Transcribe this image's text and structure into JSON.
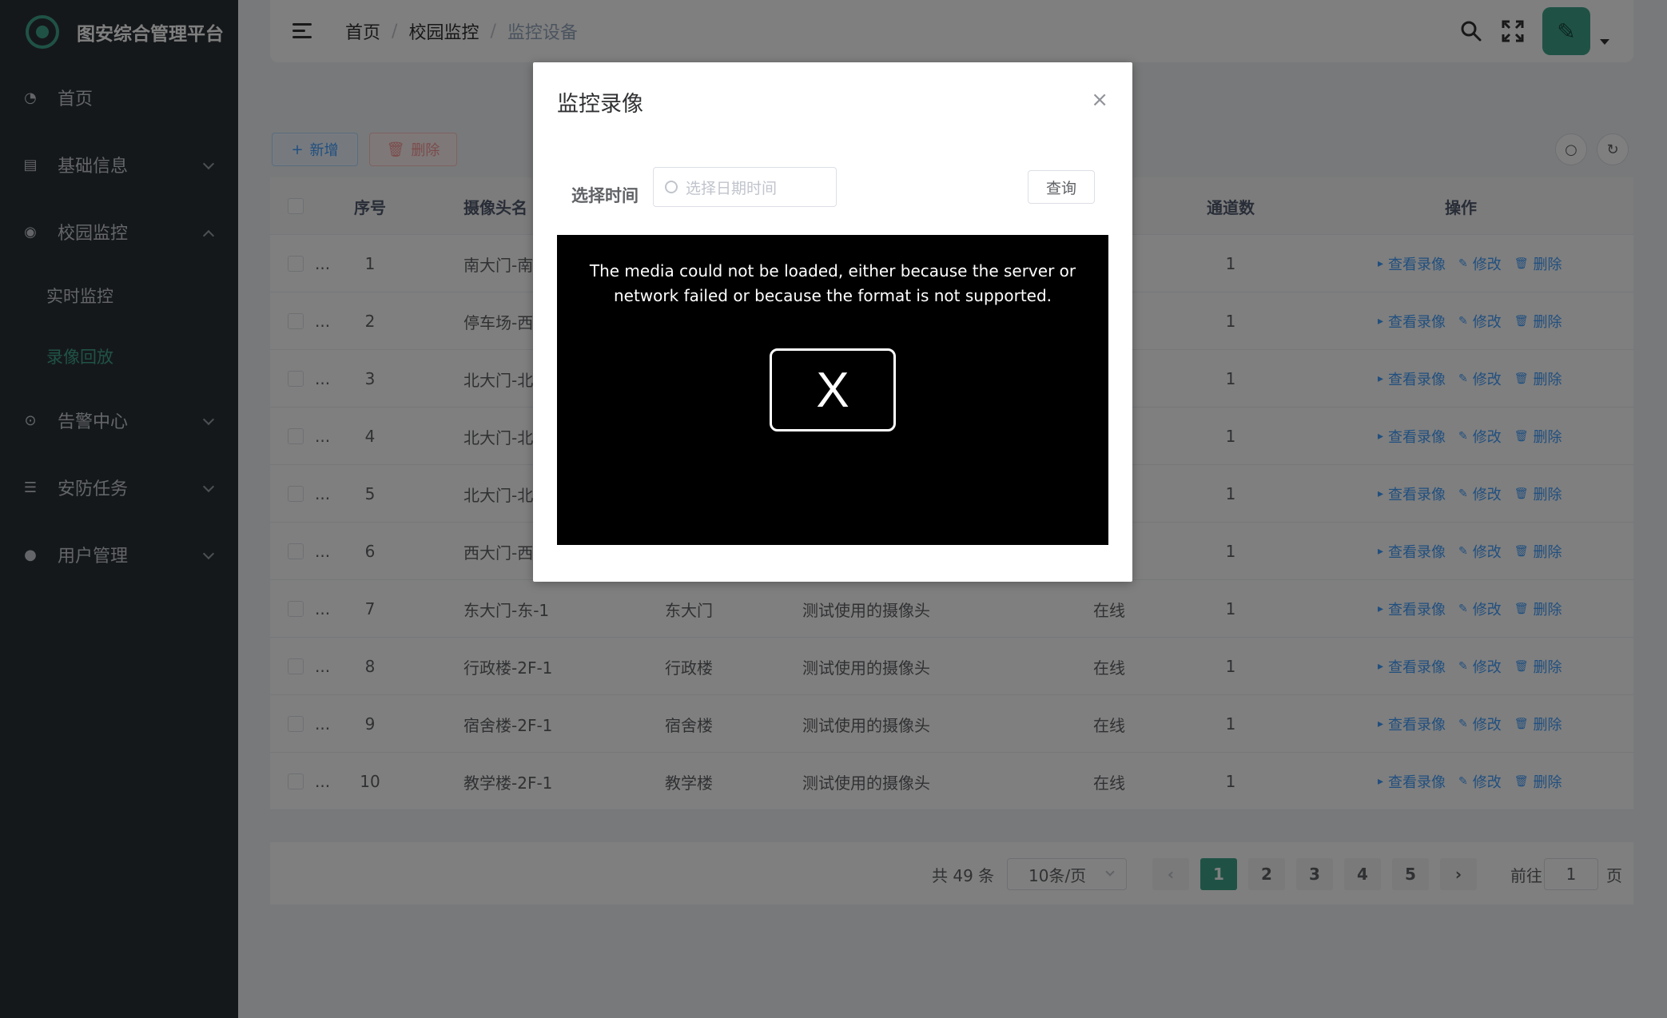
{
  "app": {
    "title": "图安综合管理平台"
  },
  "sidebar": {
    "items": [
      {
        "label": "首页",
        "icon": "dashboard-icon"
      },
      {
        "label": "基础信息",
        "icon": "document-icon"
      },
      {
        "label": "校园监控",
        "icon": "eye-icon",
        "expanded": true
      },
      {
        "label": "告警中心",
        "icon": "alarm-icon"
      },
      {
        "label": "安防任务",
        "icon": "list-icon"
      },
      {
        "label": "用户管理",
        "icon": "user-icon"
      }
    ],
    "submenu": [
      {
        "label": "实时监控"
      },
      {
        "label": "录像回放",
        "active": true
      }
    ]
  },
  "header": {
    "breadcrumb": [
      "首页",
      "校园监控",
      "监控设备"
    ],
    "separator": "/"
  },
  "toolbar": {
    "add_label": "新增",
    "delete_label": "删除"
  },
  "table": {
    "headers": {
      "index": "序号",
      "name": "摄像头名",
      "channels": "通道数",
      "ops": "操作"
    },
    "ops": {
      "view": "查看录像",
      "edit": "修改",
      "delete": "删除"
    },
    "rows": [
      {
        "index": "1",
        "name": "南大门-南",
        "area": "",
        "desc": "",
        "status": "",
        "channels": "1"
      },
      {
        "index": "2",
        "name": "停车场-西",
        "area": "",
        "desc": "",
        "status": "",
        "channels": "1"
      },
      {
        "index": "3",
        "name": "北大门-北",
        "area": "",
        "desc": "",
        "status": "",
        "channels": "1"
      },
      {
        "index": "4",
        "name": "北大门-北",
        "area": "",
        "desc": "",
        "status": "",
        "channels": "1"
      },
      {
        "index": "5",
        "name": "北大门-北",
        "area": "",
        "desc": "",
        "status": "",
        "channels": "1"
      },
      {
        "index": "6",
        "name": "西大门-西",
        "area": "",
        "desc": "",
        "status": "",
        "channels": "1"
      },
      {
        "index": "7",
        "name": "东大门-东-1",
        "area": "东大门",
        "desc": "测试使用的摄像头",
        "status": "在线",
        "channels": "1"
      },
      {
        "index": "8",
        "name": "行政楼-2F-1",
        "area": "行政楼",
        "desc": "测试使用的摄像头",
        "status": "在线",
        "channels": "1"
      },
      {
        "index": "9",
        "name": "宿舍楼-2F-1",
        "area": "宿舍楼",
        "desc": "测试使用的摄像头",
        "status": "在线",
        "channels": "1"
      },
      {
        "index": "10",
        "name": "教学楼-2F-1",
        "area": "教学楼",
        "desc": "测试使用的摄像头",
        "status": "在线",
        "channels": "1"
      }
    ]
  },
  "pagination": {
    "total": "共 49 条",
    "page_size": "10条/页",
    "pages": [
      "1",
      "2",
      "3",
      "4",
      "5"
    ],
    "current": "1",
    "goto_label": "前往",
    "goto_value": "1",
    "unit": "页"
  },
  "dialog": {
    "title": "监控录像",
    "close_symbol": "×",
    "time_label": "选择时间",
    "date_placeholder": "选择日期时间",
    "query_label": "查询",
    "video_error": "The media could not be loaded, either because the server or network failed or because the format is not supported.",
    "video_error_symbol": "X"
  },
  "colors": {
    "sidebar_bg": "#2b3137",
    "accent": "#3fa58b",
    "link": "#409eff",
    "danger": "#f56c6c"
  }
}
